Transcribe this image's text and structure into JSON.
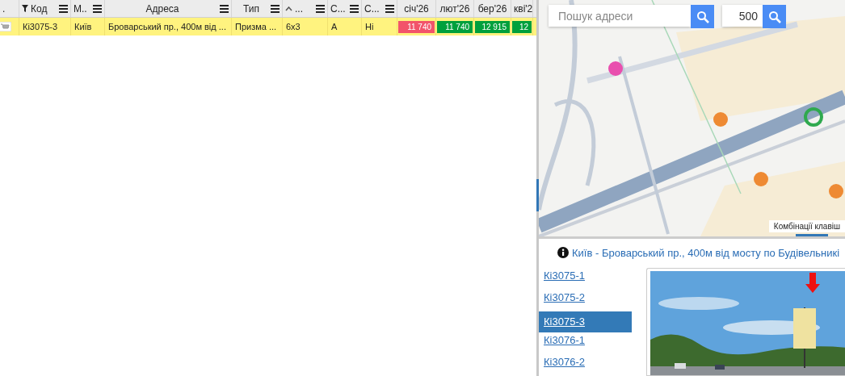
{
  "table": {
    "columns": [
      {
        "label": ".",
        "filter": false,
        "sorted": false,
        "menu": false
      },
      {
        "label": "Код",
        "filter": true,
        "sorted": false,
        "menu": true
      },
      {
        "label": "М..",
        "filter": false,
        "sorted": false,
        "menu": true
      },
      {
        "label": "Адреса",
        "filter": false,
        "sorted": false,
        "menu": true
      },
      {
        "label": "Тип",
        "filter": false,
        "sorted": false,
        "menu": true
      },
      {
        "label": "...",
        "filter": false,
        "sorted": true,
        "menu": true
      },
      {
        "label": "С...",
        "filter": false,
        "sorted": false,
        "menu": true
      },
      {
        "label": "С...",
        "filter": false,
        "sorted": false,
        "menu": true
      },
      {
        "label": "січ'26",
        "filter": false,
        "sorted": false,
        "menu": false
      },
      {
        "label": "лют'26",
        "filter": false,
        "sorted": false,
        "menu": false
      },
      {
        "label": "бер'26",
        "filter": false,
        "sorted": false,
        "menu": false
      },
      {
        "label": "кві'2",
        "filter": false,
        "sorted": false
      }
    ],
    "rows": [
      {
        "selected": true,
        "cells": [
          {
            "kind": "cart",
            "text": ""
          },
          {
            "kind": "text",
            "text": "Кі3075-3"
          },
          {
            "kind": "text",
            "text": "Київ"
          },
          {
            "kind": "text",
            "text": "Броварський пр., 400м від ..."
          },
          {
            "kind": "text",
            "text": "Призма ..."
          },
          {
            "kind": "text",
            "text": "6x3"
          },
          {
            "kind": "text",
            "text": "А"
          },
          {
            "kind": "text",
            "text": "Ні"
          },
          {
            "kind": "price",
            "text": "11 740",
            "color": "#f2546a"
          },
          {
            "kind": "price",
            "text": "11 740",
            "color": "#00a03c"
          },
          {
            "kind": "price",
            "text": "12 915",
            "color": "#00a03c"
          },
          {
            "kind": "price",
            "text": "12",
            "color": "#00a03c"
          }
        ]
      }
    ]
  },
  "map": {
    "search": {
      "placeholder": "Пошук адреси"
    },
    "radius": {
      "value": "500"
    },
    "shortcuts": "Комбінації клавіш"
  },
  "info": "Київ - Броварський пр., 400м від мосту по Будівельникі",
  "sides": [
    {
      "label": "Кі3075-1",
      "selected": false
    },
    {
      "label": "Кі3075-2",
      "selected": false
    },
    {
      "label": "Кі3075-3",
      "selected": true
    },
    {
      "label": "Кі3076-1",
      "selected": false
    },
    {
      "label": "Кі3076-2",
      "selected": false
    }
  ]
}
